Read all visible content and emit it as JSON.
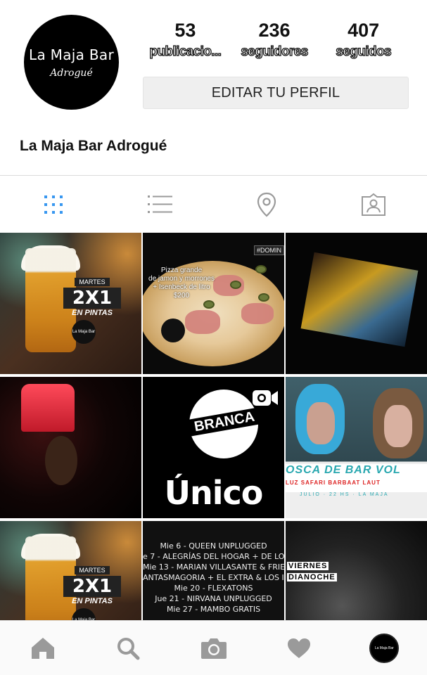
{
  "profile": {
    "avatar_text_main": "La Maja Bar",
    "avatar_text_sub": "Adrogué",
    "name": "La Maja Bar Adrogué",
    "edit_button": "EDITAR TU PERFIL"
  },
  "stats": [
    {
      "value": "53",
      "label": "publicacio..."
    },
    {
      "value": "236",
      "label": "seguidores"
    },
    {
      "value": "407",
      "label": "seguidos"
    }
  ],
  "tabs": [
    {
      "icon": "grid-icon",
      "active": true
    },
    {
      "icon": "list-icon",
      "active": false
    },
    {
      "icon": "location-pin-icon",
      "active": false
    },
    {
      "icon": "tagged-photos-icon",
      "active": false
    }
  ],
  "posts": {
    "beer": {
      "day": "MARTES",
      "promo": "2X1",
      "promo_sub": "EN PINTAS",
      "logo": "La Maja Bar"
    },
    "pizza": {
      "tag": "#DOMIN",
      "line1": "Pizza grande",
      "line2": "de jamon y morrones",
      "line3": "+ Isenbeck de litro",
      "price": "$200"
    },
    "branca": {
      "band": "BRANCA",
      "headline": "Único"
    },
    "drag": {
      "title": "OSCA DE BAR VOL",
      "subtitle": "LUZ SAFARI  BARBAAT  LAUT",
      "date_line": "JULIO · 22 HS · LA MAJA"
    },
    "lineup": [
      "Mie 6 - QUEEN UNPLUGGED",
      "e 7 - ALEGRÍAS DEL HOGAR + DE LOC",
      "Mie 13 - MARIAN VILLASANTE & FRIEND",
      "ANTASMAGORIA + EL EXTRA & LOS IM",
      "Mie 20 - FLEXATONS",
      "Jue 21 - NIRVANA UNPLUGGED",
      "Mie 27 - MAMBO GRATIS"
    ],
    "viernes": {
      "line1": "VIERNES",
      "line2": "DIANOCHE"
    }
  },
  "bottom_nav": [
    {
      "icon": "home-icon"
    },
    {
      "icon": "search-icon"
    },
    {
      "icon": "camera-icon"
    },
    {
      "icon": "heart-icon"
    },
    {
      "icon": "profile-avatar",
      "text": "La Maja Bar"
    }
  ],
  "colors": {
    "accent_blue": "#3897f0",
    "icon_gray": "#9a9a9a",
    "button_bg": "#efefef"
  }
}
